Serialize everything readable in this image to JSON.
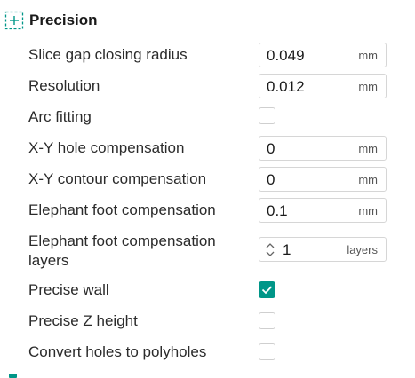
{
  "section": {
    "title": "Precision",
    "icon": "precision-icon"
  },
  "settings": [
    {
      "label": "Slice gap closing radius",
      "value": "0.049",
      "unit": "mm"
    },
    {
      "label": "Resolution",
      "value": "0.012",
      "unit": "mm"
    },
    {
      "label": "Arc fitting",
      "checked": false
    },
    {
      "label": "X-Y hole compensation",
      "value": "0",
      "unit": "mm"
    },
    {
      "label": "X-Y contour compensation",
      "value": "0",
      "unit": "mm"
    },
    {
      "label": "Elephant foot compensation",
      "value": "0.1",
      "unit": "mm"
    },
    {
      "label_line1": "Elephant foot compensation",
      "label_line2": "layers",
      "value": "1",
      "unit": "layers"
    },
    {
      "label": "Precise wall",
      "checked": true
    },
    {
      "label": "Precise Z height",
      "checked": false
    },
    {
      "label": "Convert holes to polyholes",
      "checked": false
    }
  ],
  "colors": {
    "accent": "#009688",
    "border": "#d6d6d6"
  }
}
